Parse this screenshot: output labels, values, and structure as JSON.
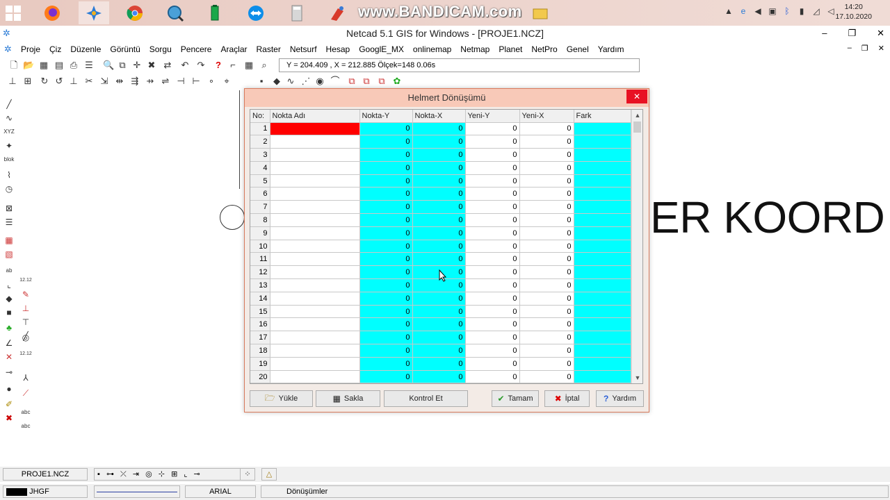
{
  "taskbar": {
    "watermark": "www.BANDICAM.com",
    "clock_time": "14:20",
    "clock_date": "17.10.2020"
  },
  "window": {
    "title": "Netcad 5.1 GIS for Windows - [PROJE1.NCZ]",
    "minimize": "–",
    "restore": "❐",
    "close": "✕"
  },
  "menu": {
    "items": [
      "Proje",
      "Çiz",
      "Düzenle",
      "Görüntü",
      "Sorgu",
      "Pencere",
      "Araçlar",
      "Raster",
      "Netsurf",
      "Hesap",
      "GooglE_MX",
      "onlinemap",
      "Netmap",
      "Planet",
      "NetPro",
      "Genel",
      "Yardım"
    ]
  },
  "toolbar": {
    "coords": "Y = 204.409 , X = 212.885  Ölçek=148  0.06s"
  },
  "canvas": {
    "big_text": "ER KOORD"
  },
  "dialog": {
    "title": "Helmert Dönüşümü",
    "close": "✕",
    "columns": [
      "No:",
      "Nokta Adı",
      "Nokta-Y",
      "Nokta-X",
      "Yeni-Y",
      "Yeni-X",
      "Fark"
    ],
    "rows": [
      [
        "1",
        "",
        "0",
        "0",
        "0",
        "0",
        ""
      ],
      [
        "2",
        "",
        "0",
        "0",
        "0",
        "0",
        ""
      ],
      [
        "3",
        "",
        "0",
        "0",
        "0",
        "0",
        ""
      ],
      [
        "4",
        "",
        "0",
        "0",
        "0",
        "0",
        ""
      ],
      [
        "5",
        "",
        "0",
        "0",
        "0",
        "0",
        ""
      ],
      [
        "6",
        "",
        "0",
        "0",
        "0",
        "0",
        ""
      ],
      [
        "7",
        "",
        "0",
        "0",
        "0",
        "0",
        ""
      ],
      [
        "8",
        "",
        "0",
        "0",
        "0",
        "0",
        ""
      ],
      [
        "9",
        "",
        "0",
        "0",
        "0",
        "0",
        ""
      ],
      [
        "10",
        "",
        "0",
        "0",
        "0",
        "0",
        ""
      ],
      [
        "11",
        "",
        "0",
        "0",
        "0",
        "0",
        ""
      ],
      [
        "12",
        "",
        "0",
        "0",
        "0",
        "0",
        ""
      ],
      [
        "13",
        "",
        "0",
        "0",
        "0",
        "0",
        ""
      ],
      [
        "14",
        "",
        "0",
        "0",
        "0",
        "0",
        ""
      ],
      [
        "15",
        "",
        "0",
        "0",
        "0",
        "0",
        ""
      ],
      [
        "16",
        "",
        "0",
        "0",
        "0",
        "0",
        ""
      ],
      [
        "17",
        "",
        "0",
        "0",
        "0",
        "0",
        ""
      ],
      [
        "18",
        "",
        "0",
        "0",
        "0",
        "0",
        ""
      ],
      [
        "19",
        "",
        "0",
        "0",
        "0",
        "0",
        ""
      ],
      [
        "20",
        "",
        "0",
        "0",
        "0",
        "0",
        ""
      ]
    ],
    "buttons": {
      "load": "Yükle",
      "save": "Sakla",
      "check": "Kontrol Et",
      "ok": "Tamam",
      "cancel": "İptal",
      "help": "Yardım"
    },
    "colors": {
      "input_cell": "#00ffff",
      "selected_cell": "#ff0000"
    }
  },
  "status": {
    "file": "PROJE1.NCZ",
    "layer": "JHGF",
    "font": "ARIAL",
    "mode": "Dönüşümler"
  }
}
